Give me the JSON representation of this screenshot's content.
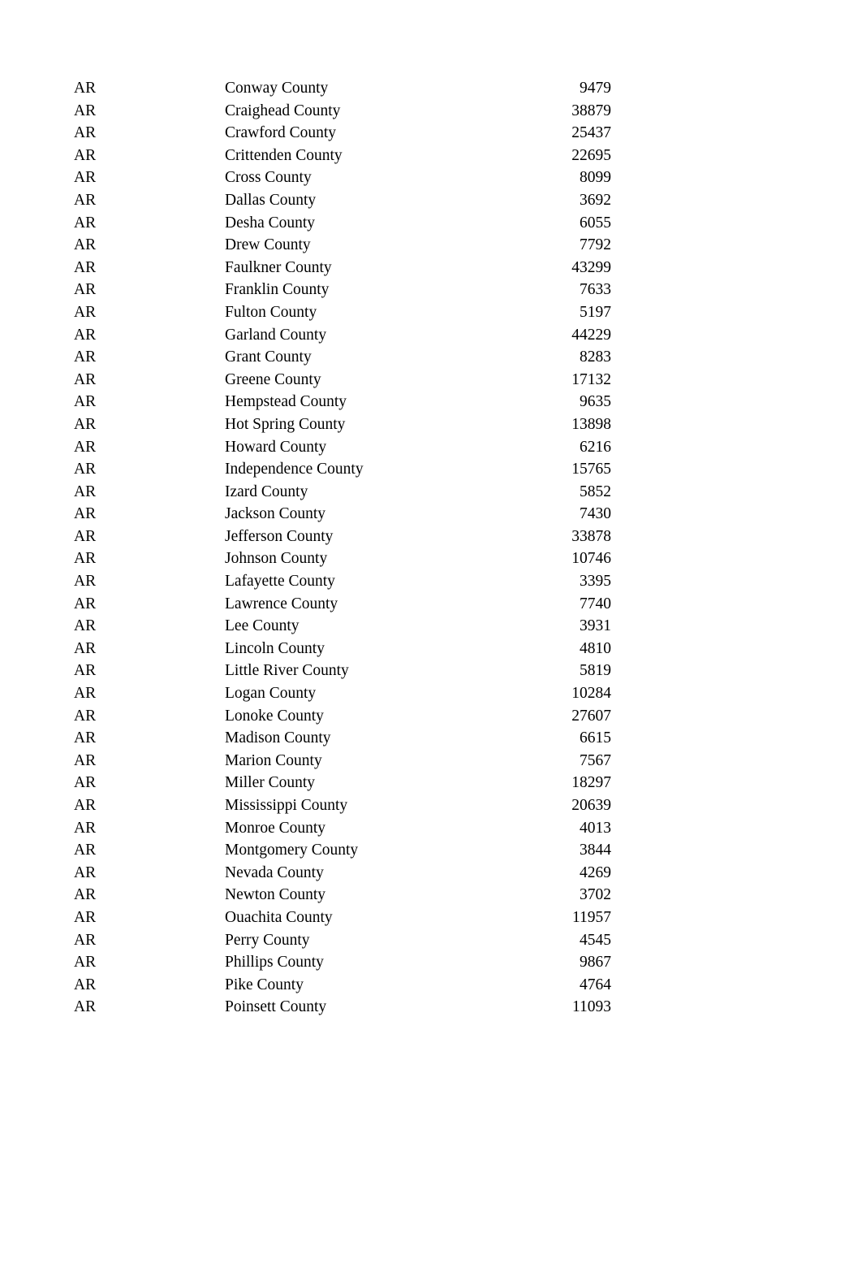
{
  "document": {
    "page_background": "#ffffff",
    "text_color": "#000000"
  },
  "table": {
    "columns": [
      {
        "key": "state",
        "align": "left"
      },
      {
        "key": "county",
        "align": "left"
      },
      {
        "key": "value",
        "align": "right"
      }
    ],
    "rows": [
      {
        "state": "AR",
        "county": "Conway County",
        "value": "9479"
      },
      {
        "state": "AR",
        "county": "Craighead County",
        "value": "38879"
      },
      {
        "state": "AR",
        "county": "Crawford County",
        "value": "25437"
      },
      {
        "state": "AR",
        "county": "Crittenden County",
        "value": "22695"
      },
      {
        "state": "AR",
        "county": "Cross County",
        "value": "8099"
      },
      {
        "state": "AR",
        "county": "Dallas County",
        "value": "3692"
      },
      {
        "state": "AR",
        "county": "Desha County",
        "value": "6055"
      },
      {
        "state": "AR",
        "county": "Drew County",
        "value": "7792"
      },
      {
        "state": "AR",
        "county": "Faulkner County",
        "value": "43299"
      },
      {
        "state": "AR",
        "county": "Franklin County",
        "value": "7633"
      },
      {
        "state": "AR",
        "county": "Fulton County",
        "value": "5197"
      },
      {
        "state": "AR",
        "county": "Garland County",
        "value": "44229"
      },
      {
        "state": "AR",
        "county": "Grant County",
        "value": "8283"
      },
      {
        "state": "AR",
        "county": "Greene County",
        "value": "17132"
      },
      {
        "state": "AR",
        "county": "Hempstead County",
        "value": "9635"
      },
      {
        "state": "AR",
        "county": "Hot Spring County",
        "value": "13898"
      },
      {
        "state": "AR",
        "county": "Howard County",
        "value": "6216"
      },
      {
        "state": "AR",
        "county": "Independence County",
        "value": "15765"
      },
      {
        "state": "AR",
        "county": "Izard County",
        "value": "5852"
      },
      {
        "state": "AR",
        "county": "Jackson County",
        "value": "7430"
      },
      {
        "state": "AR",
        "county": "Jefferson County",
        "value": "33878"
      },
      {
        "state": "AR",
        "county": "Johnson County",
        "value": "10746"
      },
      {
        "state": "AR",
        "county": "Lafayette County",
        "value": "3395"
      },
      {
        "state": "AR",
        "county": "Lawrence County",
        "value": "7740"
      },
      {
        "state": "AR",
        "county": "Lee County",
        "value": "3931"
      },
      {
        "state": "AR",
        "county": "Lincoln County",
        "value": "4810"
      },
      {
        "state": "AR",
        "county": "Little River County",
        "value": "5819"
      },
      {
        "state": "AR",
        "county": "Logan County",
        "value": "10284"
      },
      {
        "state": "AR",
        "county": "Lonoke County",
        "value": "27607"
      },
      {
        "state": "AR",
        "county": "Madison County",
        "value": "6615"
      },
      {
        "state": "AR",
        "county": "Marion County",
        "value": "7567"
      },
      {
        "state": "AR",
        "county": "Miller County",
        "value": "18297"
      },
      {
        "state": "AR",
        "county": "Mississippi County",
        "value": "20639"
      },
      {
        "state": "AR",
        "county": "Monroe County",
        "value": "4013"
      },
      {
        "state": "AR",
        "county": "Montgomery County",
        "value": "3844"
      },
      {
        "state": "AR",
        "county": "Nevada County",
        "value": "4269"
      },
      {
        "state": "AR",
        "county": "Newton County",
        "value": "3702"
      },
      {
        "state": "AR",
        "county": "Ouachita County",
        "value": "11957"
      },
      {
        "state": "AR",
        "county": "Perry County",
        "value": "4545"
      },
      {
        "state": "AR",
        "county": "Phillips County",
        "value": "9867"
      },
      {
        "state": "AR",
        "county": "Pike County",
        "value": "4764"
      },
      {
        "state": "AR",
        "county": "Poinsett County",
        "value": "11093"
      }
    ]
  }
}
